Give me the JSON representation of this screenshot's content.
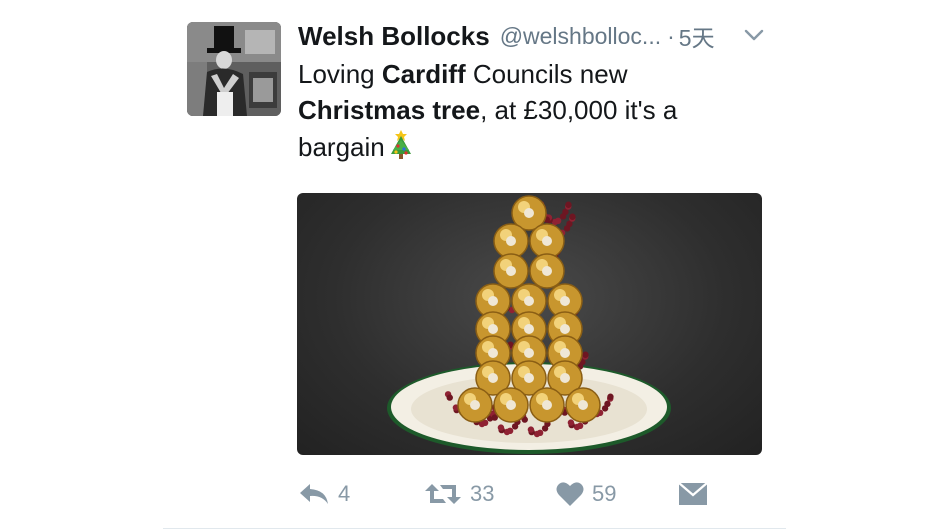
{
  "tweet": {
    "display_name": "Welsh Bollocks",
    "handle": "@welshbolloc...",
    "separator": "·",
    "time": "5天",
    "text": {
      "part1": "Loving ",
      "bold1": "Cardiff",
      "part2": " Councils new ",
      "bold2": "Christmas tree",
      "part3": ", at £30,000 it's a bargain",
      "emoji": "christmas-tree-emoji"
    }
  },
  "actions": {
    "reply_icon": "reply-icon",
    "reply_count": "4",
    "retweet_icon": "retweet-icon",
    "retweet_count": "33",
    "like_icon": "heart-icon",
    "like_count": "59",
    "dm_icon": "envelope-icon"
  },
  "colors": {
    "text": "#14171a",
    "muted": "#657786",
    "action": "#8899a6",
    "divider": "#e1e8ed"
  }
}
